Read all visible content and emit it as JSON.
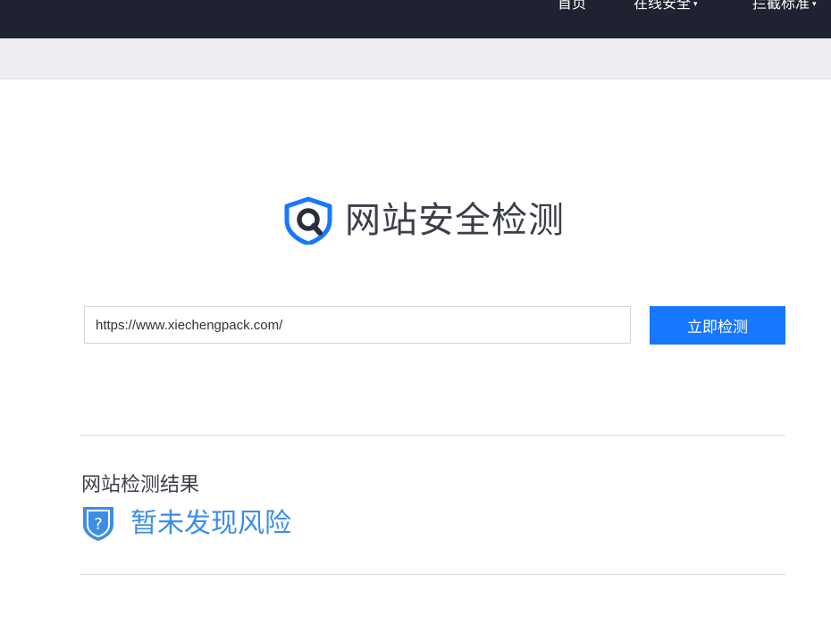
{
  "nav": {
    "items": [
      {
        "label": "首页",
        "has_caret": false
      },
      {
        "label": "在线安全",
        "caret": "▾"
      },
      {
        "label": "拦截标准",
        "caret": "▾"
      }
    ]
  },
  "brand": {
    "logo_icon": "shield-search-icon",
    "title": "网站安全检测",
    "accent_color": "#1677ff"
  },
  "search": {
    "value": "https://www.xiechengpack.com/",
    "button_label": "立即检测"
  },
  "result": {
    "heading": "网站检测结果",
    "status_icon": "shield-question-icon",
    "status_text": "暂未发现风险",
    "status_color": "#3d8ee6"
  }
}
